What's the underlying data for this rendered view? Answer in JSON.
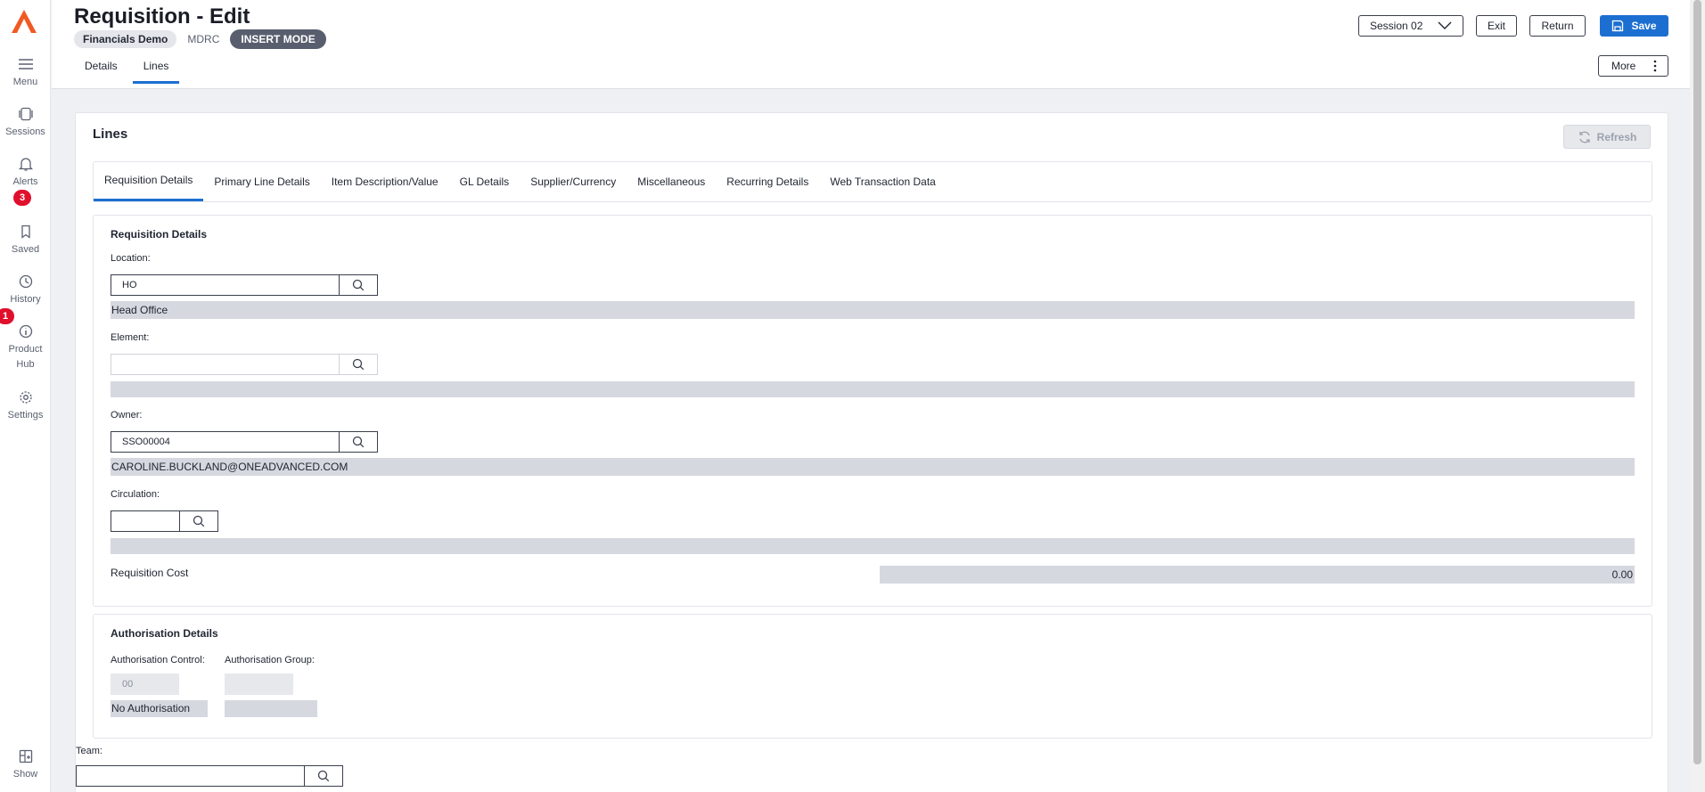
{
  "header": {
    "title": "Requisition - Edit",
    "chips": {
      "company": "Financials Demo",
      "code": "MDRC",
      "mode": "INSERT MODE"
    },
    "tabs": [
      {
        "label": "Details",
        "active": false
      },
      {
        "label": "Lines",
        "active": true
      }
    ],
    "session_label": "Session 02",
    "exit_label": "Exit",
    "return_label": "Return",
    "save_label": "Save",
    "more_label": "More"
  },
  "rail": {
    "items": [
      {
        "label": "Menu",
        "icon": "menu-icon"
      },
      {
        "label": "Sessions",
        "icon": "sessions-icon"
      },
      {
        "label": "Alerts",
        "icon": "bell-icon",
        "badge": "3"
      },
      {
        "label": "Saved",
        "icon": "bookmark-icon"
      },
      {
        "label": "History",
        "icon": "clock-icon"
      },
      {
        "label": "Product",
        "label2": "Hub",
        "icon": "info-icon",
        "badge": "1"
      },
      {
        "label": "Settings",
        "icon": "gear-icon"
      },
      {
        "label": "Show",
        "icon": "layout-icon"
      }
    ]
  },
  "card": {
    "title": "Lines",
    "refresh_label": "Refresh",
    "subtabs": [
      {
        "label": "Requisition Details",
        "active": true
      },
      {
        "label": "Primary Line Details",
        "active": false
      },
      {
        "label": "Item Description/Value",
        "active": false
      },
      {
        "label": "GL Details",
        "active": false
      },
      {
        "label": "Supplier/Currency",
        "active": false
      },
      {
        "label": "Miscellaneous",
        "active": false
      },
      {
        "label": "Recurring Details",
        "active": false
      },
      {
        "label": "Web Transaction Data",
        "active": false
      }
    ]
  },
  "req_details": {
    "title": "Requisition Details",
    "location": {
      "label": "Location:",
      "value": "HO",
      "description": "Head Office"
    },
    "element": {
      "label": "Element:",
      "value": "",
      "description": ""
    },
    "owner": {
      "label": "Owner:",
      "value": "SSO00004",
      "description": "CAROLINE.BUCKLAND@ONEADVANCED.COM"
    },
    "circulation": {
      "label": "Circulation:",
      "value": "",
      "description": ""
    },
    "cost": {
      "label": "Requisition Cost",
      "value": "0.00"
    }
  },
  "auth_details": {
    "title": "Authorisation Details",
    "control_label": "Authorisation Control:",
    "control_value": "00",
    "control_description": "No Authorisation",
    "group_label": "Authorisation Group:",
    "group_value": "",
    "group_description": ""
  },
  "team": {
    "label": "Team:",
    "value": ""
  },
  "colors": {
    "accent": "#1c6fd1",
    "badge": "#e0102c",
    "logo": "#f05a22"
  }
}
